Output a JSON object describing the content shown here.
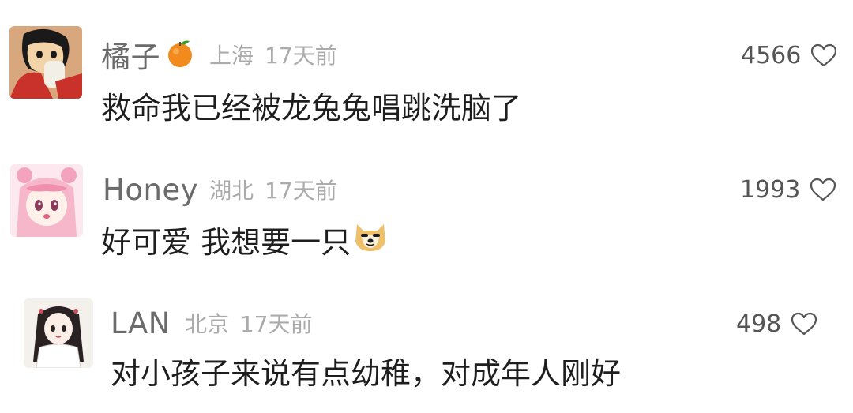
{
  "comments": [
    {
      "username": "橘子",
      "emoji": "orange-emoji",
      "location": "上海",
      "time": "17天前",
      "text": "救命我已经被龙兔兔唱跳洗脑了",
      "likes": "4566"
    },
    {
      "username": "Honey",
      "location": "湖北",
      "time": "17天前",
      "text": "好可爱 我想要一只",
      "text_emoji": "doge-emoji",
      "likes": "1993"
    },
    {
      "username": "LAN",
      "location": "北京",
      "time": "17天前",
      "text": "对小孩子来说有点幼稚，对成年人刚好",
      "likes": "498"
    }
  ],
  "colors": {
    "username": "#6b6b6b",
    "meta": "#ababab",
    "text": "#1e1e1e",
    "likes": "#555555"
  }
}
